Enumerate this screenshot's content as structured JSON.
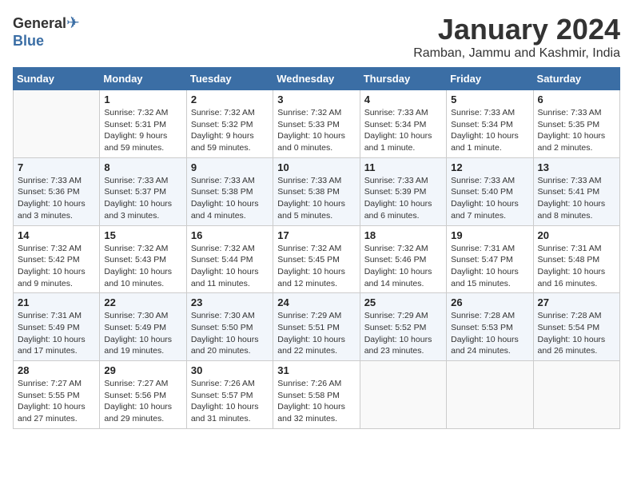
{
  "header": {
    "logo_general": "General",
    "logo_blue": "Blue",
    "title": "January 2024",
    "subtitle": "Ramban, Jammu and Kashmir, India"
  },
  "days_of_week": [
    "Sunday",
    "Monday",
    "Tuesday",
    "Wednesday",
    "Thursday",
    "Friday",
    "Saturday"
  ],
  "weeks": [
    [
      {
        "day": "",
        "info": ""
      },
      {
        "day": "1",
        "info": "Sunrise: 7:32 AM\nSunset: 5:31 PM\nDaylight: 9 hours\nand 59 minutes."
      },
      {
        "day": "2",
        "info": "Sunrise: 7:32 AM\nSunset: 5:32 PM\nDaylight: 9 hours\nand 59 minutes."
      },
      {
        "day": "3",
        "info": "Sunrise: 7:32 AM\nSunset: 5:33 PM\nDaylight: 10 hours\nand 0 minutes."
      },
      {
        "day": "4",
        "info": "Sunrise: 7:33 AM\nSunset: 5:34 PM\nDaylight: 10 hours\nand 1 minute."
      },
      {
        "day": "5",
        "info": "Sunrise: 7:33 AM\nSunset: 5:34 PM\nDaylight: 10 hours\nand 1 minute."
      },
      {
        "day": "6",
        "info": "Sunrise: 7:33 AM\nSunset: 5:35 PM\nDaylight: 10 hours\nand 2 minutes."
      }
    ],
    [
      {
        "day": "7",
        "info": "Sunrise: 7:33 AM\nSunset: 5:36 PM\nDaylight: 10 hours\nand 3 minutes."
      },
      {
        "day": "8",
        "info": "Sunrise: 7:33 AM\nSunset: 5:37 PM\nDaylight: 10 hours\nand 3 minutes."
      },
      {
        "day": "9",
        "info": "Sunrise: 7:33 AM\nSunset: 5:38 PM\nDaylight: 10 hours\nand 4 minutes."
      },
      {
        "day": "10",
        "info": "Sunrise: 7:33 AM\nSunset: 5:38 PM\nDaylight: 10 hours\nand 5 minutes."
      },
      {
        "day": "11",
        "info": "Sunrise: 7:33 AM\nSunset: 5:39 PM\nDaylight: 10 hours\nand 6 minutes."
      },
      {
        "day": "12",
        "info": "Sunrise: 7:33 AM\nSunset: 5:40 PM\nDaylight: 10 hours\nand 7 minutes."
      },
      {
        "day": "13",
        "info": "Sunrise: 7:33 AM\nSunset: 5:41 PM\nDaylight: 10 hours\nand 8 minutes."
      }
    ],
    [
      {
        "day": "14",
        "info": "Sunrise: 7:32 AM\nSunset: 5:42 PM\nDaylight: 10 hours\nand 9 minutes."
      },
      {
        "day": "15",
        "info": "Sunrise: 7:32 AM\nSunset: 5:43 PM\nDaylight: 10 hours\nand 10 minutes."
      },
      {
        "day": "16",
        "info": "Sunrise: 7:32 AM\nSunset: 5:44 PM\nDaylight: 10 hours\nand 11 minutes."
      },
      {
        "day": "17",
        "info": "Sunrise: 7:32 AM\nSunset: 5:45 PM\nDaylight: 10 hours\nand 12 minutes."
      },
      {
        "day": "18",
        "info": "Sunrise: 7:32 AM\nSunset: 5:46 PM\nDaylight: 10 hours\nand 14 minutes."
      },
      {
        "day": "19",
        "info": "Sunrise: 7:31 AM\nSunset: 5:47 PM\nDaylight: 10 hours\nand 15 minutes."
      },
      {
        "day": "20",
        "info": "Sunrise: 7:31 AM\nSunset: 5:48 PM\nDaylight: 10 hours\nand 16 minutes."
      }
    ],
    [
      {
        "day": "21",
        "info": "Sunrise: 7:31 AM\nSunset: 5:49 PM\nDaylight: 10 hours\nand 17 minutes."
      },
      {
        "day": "22",
        "info": "Sunrise: 7:30 AM\nSunset: 5:49 PM\nDaylight: 10 hours\nand 19 minutes."
      },
      {
        "day": "23",
        "info": "Sunrise: 7:30 AM\nSunset: 5:50 PM\nDaylight: 10 hours\nand 20 minutes."
      },
      {
        "day": "24",
        "info": "Sunrise: 7:29 AM\nSunset: 5:51 PM\nDaylight: 10 hours\nand 22 minutes."
      },
      {
        "day": "25",
        "info": "Sunrise: 7:29 AM\nSunset: 5:52 PM\nDaylight: 10 hours\nand 23 minutes."
      },
      {
        "day": "26",
        "info": "Sunrise: 7:28 AM\nSunset: 5:53 PM\nDaylight: 10 hours\nand 24 minutes."
      },
      {
        "day": "27",
        "info": "Sunrise: 7:28 AM\nSunset: 5:54 PM\nDaylight: 10 hours\nand 26 minutes."
      }
    ],
    [
      {
        "day": "28",
        "info": "Sunrise: 7:27 AM\nSunset: 5:55 PM\nDaylight: 10 hours\nand 27 minutes."
      },
      {
        "day": "29",
        "info": "Sunrise: 7:27 AM\nSunset: 5:56 PM\nDaylight: 10 hours\nand 29 minutes."
      },
      {
        "day": "30",
        "info": "Sunrise: 7:26 AM\nSunset: 5:57 PM\nDaylight: 10 hours\nand 31 minutes."
      },
      {
        "day": "31",
        "info": "Sunrise: 7:26 AM\nSunset: 5:58 PM\nDaylight: 10 hours\nand 32 minutes."
      },
      {
        "day": "",
        "info": ""
      },
      {
        "day": "",
        "info": ""
      },
      {
        "day": "",
        "info": ""
      }
    ]
  ]
}
